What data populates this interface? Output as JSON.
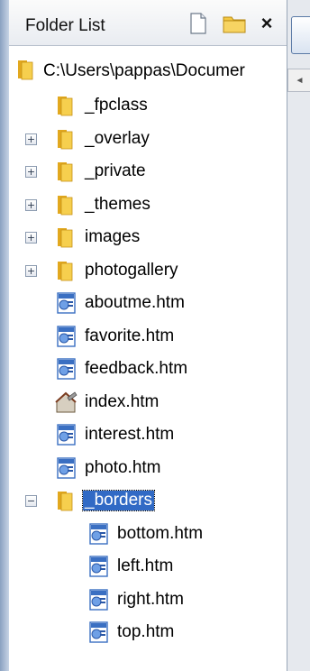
{
  "panel": {
    "title": "Folder List",
    "buttons": {
      "new_page": "new-page-icon",
      "new_folder": "new-folder-icon",
      "close": "×"
    }
  },
  "tree": {
    "root": {
      "label": "C:\\Users\\pappas\\Documer",
      "icon": "folder-icon"
    },
    "items": [
      {
        "label": "_fpclass",
        "icon": "folder-icon",
        "expander": ""
      },
      {
        "label": "_overlay",
        "icon": "folder-icon",
        "expander": "+"
      },
      {
        "label": "_private",
        "icon": "folder-icon",
        "expander": "+"
      },
      {
        "label": "_themes",
        "icon": "folder-icon",
        "expander": "+"
      },
      {
        "label": "images",
        "icon": "folder-icon",
        "expander": "+"
      },
      {
        "label": "photogallery",
        "icon": "folder-icon",
        "expander": "+"
      },
      {
        "label": "aboutme.htm",
        "icon": "web-page-icon",
        "expander": ""
      },
      {
        "label": "favorite.htm",
        "icon": "web-page-icon",
        "expander": ""
      },
      {
        "label": "feedback.htm",
        "icon": "web-page-icon",
        "expander": ""
      },
      {
        "label": "index.htm",
        "icon": "home-page-icon",
        "expander": ""
      },
      {
        "label": "interest.htm",
        "icon": "web-page-icon",
        "expander": ""
      },
      {
        "label": "photo.htm",
        "icon": "web-page-icon",
        "expander": ""
      },
      {
        "label": "_borders",
        "icon": "folder-icon",
        "expander": "−",
        "selected": true
      }
    ],
    "borders_children": [
      {
        "label": "bottom.htm",
        "icon": "web-page-icon"
      },
      {
        "label": "left.htm",
        "icon": "web-page-icon"
      },
      {
        "label": "right.htm",
        "icon": "web-page-icon"
      },
      {
        "label": "top.htm",
        "icon": "web-page-icon"
      }
    ]
  },
  "colors": {
    "selection": "#316ac5",
    "folder": "#f2c73c",
    "page_blue": "#3a6fc2"
  },
  "right_scroll_arrow": "◄"
}
